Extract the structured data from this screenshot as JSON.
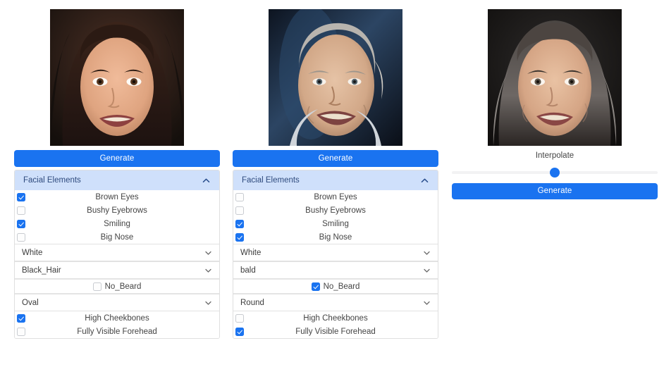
{
  "accent": "#1a73f0",
  "header_bg": "#cfe0fb",
  "columns": [
    {
      "name": "source-a",
      "portrait_alt": "young-woman-dark-hair-smiling",
      "generate_label": "Generate",
      "accordion": {
        "title": "Facial Elements",
        "chevron": "chevron-up-icon",
        "expanded": true
      },
      "checks_top": [
        {
          "label": "Brown Eyes",
          "checked": true
        },
        {
          "label": "Bushy Eyebrows",
          "checked": false
        },
        {
          "label": "Smiling",
          "checked": true
        },
        {
          "label": "Big Nose",
          "checked": false
        }
      ],
      "skin_select": {
        "value": "White",
        "chevron": "chevron-down-icon"
      },
      "hair_select": {
        "value": "Black_Hair",
        "chevron": "chevron-down-icon"
      },
      "beard_check": {
        "label": "No_Beard",
        "checked": false
      },
      "face_select": {
        "value": "Oval",
        "chevron": "chevron-down-icon"
      },
      "checks_bottom": [
        {
          "label": "High Cheekbones",
          "checked": true
        },
        {
          "label": "Fully Visible Forehead",
          "checked": false
        }
      ]
    },
    {
      "name": "source-b",
      "portrait_alt": "older-man-grey-hair-smiling",
      "generate_label": "Generate",
      "accordion": {
        "title": "Facial Elements",
        "chevron": "chevron-up-icon",
        "expanded": true
      },
      "checks_top": [
        {
          "label": "Brown Eyes",
          "checked": false
        },
        {
          "label": "Bushy Eyebrows",
          "checked": false
        },
        {
          "label": "Smiling",
          "checked": true
        },
        {
          "label": "Big Nose",
          "checked": true
        }
      ],
      "skin_select": {
        "value": "White",
        "chevron": "chevron-down-icon"
      },
      "hair_select": {
        "value": "bald",
        "chevron": "chevron-down-icon"
      },
      "beard_check": {
        "label": "No_Beard",
        "checked": true
      },
      "face_select": {
        "value": "Round",
        "chevron": "chevron-down-icon"
      },
      "checks_bottom": [
        {
          "label": "High Cheekbones",
          "checked": false
        },
        {
          "label": "Fully Visible Forehead",
          "checked": true
        }
      ]
    }
  ],
  "interpolate": {
    "name": "interpolate",
    "portrait_alt": "interpolated-woman-grey-streaked-hair-smiling",
    "label": "Interpolate",
    "slider": {
      "value": 50,
      "min": 0,
      "max": 100
    },
    "generate_label": "Generate"
  }
}
